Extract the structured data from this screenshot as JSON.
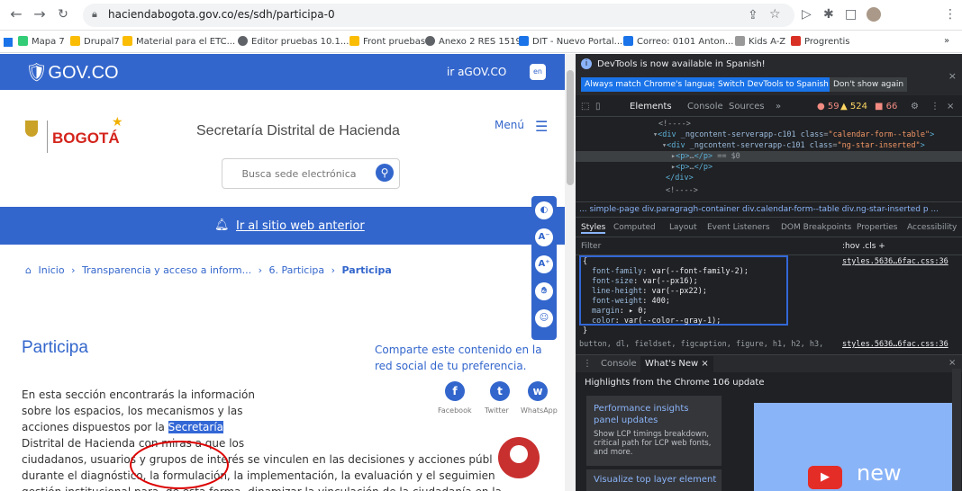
{
  "browser": {
    "url": "haciendabogota.gov.co/es/sdh/participa-0",
    "bookmarks": [
      {
        "label": "Mapa 7",
        "color": "#3c7"
      },
      {
        "label": "Drupal7",
        "color": "#fbbc04"
      },
      {
        "label": "Material para el ETC...",
        "color": "#fbbc04"
      },
      {
        "label": "Editor pruebas 10.1...",
        "color": "#5f6368"
      },
      {
        "label": "Front pruebas",
        "color": "#fbbc04"
      },
      {
        "label": "Anexo 2 RES 1519",
        "color": "#5f6368"
      },
      {
        "label": "DIT - Nuevo Portal...",
        "color": "#1a73e8"
      },
      {
        "label": "Correo: 0101 Anton...",
        "color": "#1a73e8"
      },
      {
        "label": "Kids A-Z",
        "color": "#999999"
      },
      {
        "label": "Progrentis",
        "color": "#d93025"
      }
    ],
    "bookmarks_more": "»"
  },
  "site": {
    "gov_logo": "GOV.CO",
    "gov_link": "ir aGOV.CO",
    "lang": "en",
    "brand": "BOGOTÁ",
    "title": "Secretaría Distrital de Hacienda",
    "menu_label": "Menú",
    "search_placeholder": "Busca sede electrónica",
    "old_site_link": "Ir al sitio web anterior",
    "breadcrumb": [
      "Inicio",
      "Transparencia y acceso a inform...",
      "6. Participa",
      "Participa"
    ],
    "page_title": "Participa",
    "share_text": "Comparte este contenido en la red social de tu preferencia.",
    "social": [
      {
        "label": "Facebook",
        "glyph": "f"
      },
      {
        "label": "Twitter",
        "glyph": "t"
      },
      {
        "label": "WhatsApp",
        "glyph": "w"
      }
    ],
    "body_lines": [
      "En esta sección encontrarás la información",
      "sobre los espacios, los mecanismos y las",
      "acciones dispuestos por la ",
      "Distrital de Hacienda con miras a que los",
      "ciudadanos, usuarios y grupos de interés se vinculen en las decisiones y acciones públ",
      "durante el diagnóstico, la formulación, la implementación, la evaluación y el seguimien",
      "gestión institucional para, de esta forma, dinamizar la vinculación de la ciudadanía en la"
    ],
    "body_highlight": "Secretaría"
  },
  "devtools": {
    "banner": "DevTools is now available in Spanish!",
    "btn_match": "Always match Chrome's language",
    "btn_switch": "Switch DevTools to Spanish",
    "btn_dismiss": "Don't show again",
    "tabs": [
      "Elements",
      "Console",
      "Sources",
      "»"
    ],
    "errors": "59",
    "warnings": "524",
    "issues": "66",
    "breadcrumb": "... simple-page   div.paragragh-container   div.calendar-form--table   div.ng-star-inserted   p   ...",
    "style_tabs": [
      "Styles",
      "Computed",
      "Layout",
      "Event Listeners",
      "DOM Breakpoints",
      "Properties",
      "Accessibility"
    ],
    "filter_placeholder": "Filter",
    "filter_tools": ":hov  .cls  +",
    "stylesheet": "styles.5636…6fac.css:36",
    "css_rules": [
      {
        "prop": "font-family",
        "value": "var(--font-family-2);"
      },
      {
        "prop": "font-size",
        "value": "var(--px16);"
      },
      {
        "prop": "line-height",
        "value": "var(--px22);"
      },
      {
        "prop": "font-weight",
        "value": "400;"
      },
      {
        "prop": "margin",
        "value": "▸ 0;"
      },
      {
        "prop": "color",
        "value": "var(--color--gray-1);"
      }
    ],
    "selector_line": "button, dl, fieldset, figcaption, figure, h1, h2, h3,",
    "console_tabs": [
      "Console",
      "What's New ×"
    ],
    "whats_new": "Highlights from the Chrome 106 update",
    "card1_title": "Performance insights panel updates",
    "card1_body": "Show LCP timings breakdown, critical path for LCP web fonts, and more.",
    "card2_title": "Visualize top layer element",
    "video_label": "new"
  }
}
